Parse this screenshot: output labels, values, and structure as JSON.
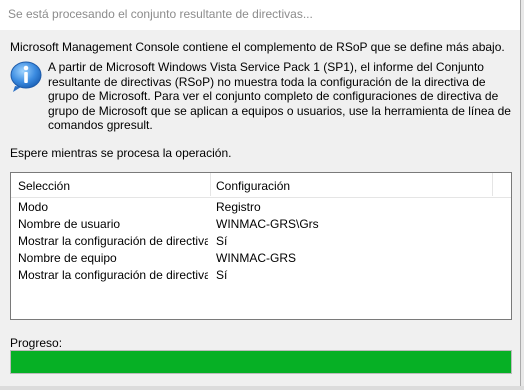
{
  "dialog": {
    "title": "Se está procesando el conjunto resultante de directivas...",
    "intro": "Microsoft Management Console contiene el complemento de RSoP que se define más abajo.",
    "note": "A partir de Microsoft Windows Vista Service Pack 1 (SP1), el informe del Conjunto resultante de directivas (RSoP) no muestra toda la configuración de la directiva de grupo de Microsoft. Para ver el conjunto completo de configuraciones de directiva de grupo de Microsoft que se aplican a equipos o usuarios, use la herramienta de línea de comandos gpresult.",
    "wait": "Espere mientras se procesa la operación.",
    "icon": "info-icon"
  },
  "table": {
    "columns": [
      "Selección",
      "Configuración"
    ],
    "rows": [
      [
        "Modo",
        "Registro"
      ],
      [
        "Nombre de usuario",
        "WINMAC-GRS\\Grs"
      ],
      [
        "Mostrar la configuración de directivas ...",
        "Sí"
      ],
      [
        "Nombre de equipo",
        "WINMAC-GRS"
      ],
      [
        "Mostrar la configuración de directivas ...",
        "Sí"
      ]
    ]
  },
  "progress": {
    "label": "Progreso:",
    "percent": 100,
    "color": "#06b025"
  }
}
